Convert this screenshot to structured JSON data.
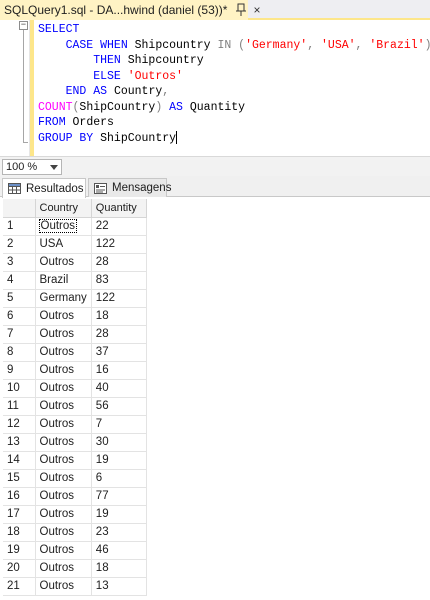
{
  "window": {
    "tab_title": "SQLQuery1.sql - DA...hwind (daniel (53))*",
    "close_glyph": "×",
    "accent_color": "#fde68a"
  },
  "editor": {
    "lines": [
      [
        {
          "t": "SELECT",
          "c": "kw"
        }
      ],
      [
        {
          "t": "    CASE WHEN ",
          "c": "kw"
        },
        {
          "t": "Shipcountry ",
          "c": "id"
        },
        {
          "t": "IN ",
          "c": "gr"
        },
        {
          "t": "(",
          "c": "gr"
        },
        {
          "t": "'Germany'",
          "c": "str"
        },
        {
          "t": ", ",
          "c": "gr"
        },
        {
          "t": "'USA'",
          "c": "str"
        },
        {
          "t": ", ",
          "c": "gr"
        },
        {
          "t": "'Brazil'",
          "c": "str"
        },
        {
          "t": ")",
          "c": "gr"
        }
      ],
      [
        {
          "t": "        THEN ",
          "c": "kw"
        },
        {
          "t": "Shipcountry",
          "c": "id"
        }
      ],
      [
        {
          "t": "        ELSE ",
          "c": "kw"
        },
        {
          "t": "'Outros'",
          "c": "str"
        }
      ],
      [
        {
          "t": "    END ",
          "c": "kw"
        },
        {
          "t": "AS ",
          "c": "kw"
        },
        {
          "t": "Country",
          "c": "id"
        },
        {
          "t": ",",
          "c": "gr"
        }
      ],
      [
        {
          "t": "COUNT",
          "c": "fn"
        },
        {
          "t": "(",
          "c": "gr"
        },
        {
          "t": "ShipCountry",
          "c": "id"
        },
        {
          "t": ") ",
          "c": "gr"
        },
        {
          "t": "AS ",
          "c": "kw"
        },
        {
          "t": "Quantity",
          "c": "id"
        }
      ],
      [
        {
          "t": "FROM ",
          "c": "kw"
        },
        {
          "t": "Orders",
          "c": "id"
        }
      ],
      [
        {
          "t": "GROUP BY ",
          "c": "kw"
        },
        {
          "t": "ShipCountry",
          "c": "id"
        }
      ]
    ]
  },
  "zoom": {
    "value": "100 %"
  },
  "results_tabs": {
    "results_label": "Resultados",
    "messages_label": "Mensagens"
  },
  "grid": {
    "columns": [
      "Country",
      "Quantity"
    ],
    "rows": [
      {
        "n": "1",
        "country": "Outros",
        "qty": "22"
      },
      {
        "n": "2",
        "country": "USA",
        "qty": "122"
      },
      {
        "n": "3",
        "country": "Outros",
        "qty": "28"
      },
      {
        "n": "4",
        "country": "Brazil",
        "qty": "83"
      },
      {
        "n": "5",
        "country": "Germany",
        "qty": "122"
      },
      {
        "n": "6",
        "country": "Outros",
        "qty": "18"
      },
      {
        "n": "7",
        "country": "Outros",
        "qty": "28"
      },
      {
        "n": "8",
        "country": "Outros",
        "qty": "37"
      },
      {
        "n": "9",
        "country": "Outros",
        "qty": "16"
      },
      {
        "n": "10",
        "country": "Outros",
        "qty": "40"
      },
      {
        "n": "11",
        "country": "Outros",
        "qty": "56"
      },
      {
        "n": "12",
        "country": "Outros",
        "qty": "7"
      },
      {
        "n": "13",
        "country": "Outros",
        "qty": "30"
      },
      {
        "n": "14",
        "country": "Outros",
        "qty": "19"
      },
      {
        "n": "15",
        "country": "Outros",
        "qty": "6"
      },
      {
        "n": "16",
        "country": "Outros",
        "qty": "77"
      },
      {
        "n": "17",
        "country": "Outros",
        "qty": "19"
      },
      {
        "n": "18",
        "country": "Outros",
        "qty": "23"
      },
      {
        "n": "19",
        "country": "Outros",
        "qty": "46"
      },
      {
        "n": "20",
        "country": "Outros",
        "qty": "18"
      },
      {
        "n": "21",
        "country": "Outros",
        "qty": "13"
      }
    ]
  }
}
